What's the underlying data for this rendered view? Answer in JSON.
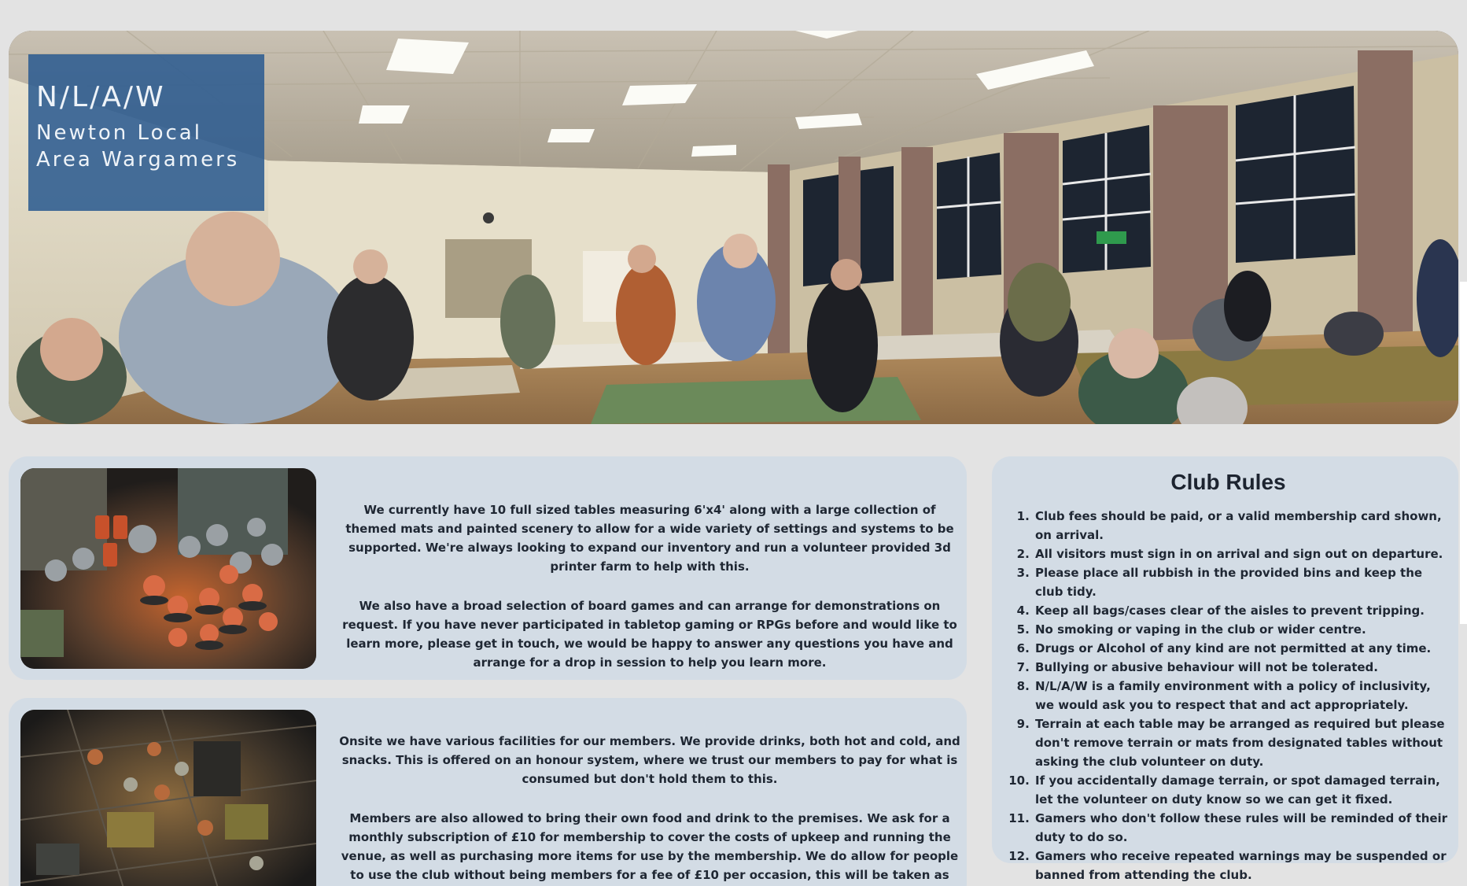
{
  "hero": {
    "abbr": "N/L/A/W",
    "name": "Newton Local Area Wargamers",
    "image_description_icon": "club-hall-photo"
  },
  "sections": [
    {
      "image_icon": "painted-miniatures-photo",
      "paragraphs": [
        "We currently have 10 full sized tables measuring 6'x4' along with a large collection of themed mats and painted scenery to allow for a wide variety of settings and systems to be supported. We're always looking to expand our inventory and run a volunteer provided 3d printer farm to help with this.",
        "We also have a broad selection of board games and can arrange for demonstrations on request. If you have never participated in tabletop gaming or RPGs before and would like to learn more, please get in touch, we would be happy to answer any questions you have and arrange for a drop in session to help you learn more."
      ]
    },
    {
      "image_icon": "miniatures-game-board-photo",
      "paragraphs": [
        "Onsite we have various facilities for our members. We provide drinks, both hot and cold, and snacks. This is offered on an honour system, where we trust our members to pay for what is consumed but don't hold them to this.",
        "Members are also allowed to bring their own food and drink to the premises. We ask for a monthly subscription of £10 for membership to cover the costs of upkeep and running the venue, as well as purchasing more items for use by the membership. We do allow for people to use the club without being members for a fee of £10 per occasion, this will be taken as your monthly fee if you choose to join us."
      ]
    }
  ],
  "rules": {
    "title": "Club Rules",
    "items": [
      "Club fees should be paid, or a valid membership card shown, on arrival.",
      "All visitors must sign in on arrival and sign out on departure.",
      "Please place all rubbish in the provided bins and keep the club tidy.",
      "Keep all bags/cases clear of the aisles to prevent tripping.",
      "No smoking or vaping in the club or wider centre.",
      "Drugs or Alcohol of any kind are not permitted at any time.",
      "Bullying or abusive behaviour will not be tolerated.",
      "N/L/A/W is a family environment with a policy of inclusivity, we would ask you to respect that and act appropriately.",
      "Terrain at each table may be arranged as required but please don't remove terrain or mats from designated tables without asking the club volunteer on duty.",
      "If you accidentally damage terrain, or spot damaged terrain, let the volunteer on duty know so we can get it fixed.",
      "Gamers who don't follow these rules will be reminded of their duty to do so.",
      "Gamers who receive repeated warnings may be suspended or banned from attending the club."
    ]
  },
  "colors": {
    "page_background": "#e3e3e3",
    "card_background": "#d3dce5",
    "title_box": "#2d5c91",
    "text": "#1f2733"
  }
}
